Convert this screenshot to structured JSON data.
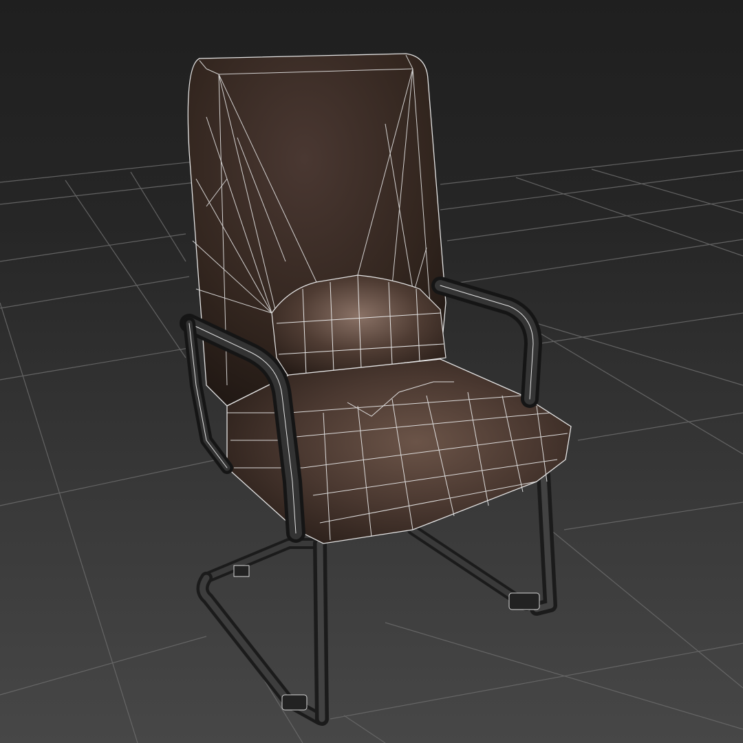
{
  "viewport": {
    "background_top": "#1f1f1f",
    "background_bottom": "#474747",
    "grid_color": "#6a6a6a",
    "wireframe_color": "#e8e8e8"
  },
  "model": {
    "object": "chair-model",
    "upholstery": "#3a2a24",
    "upholstery_highlight": "#7a6458",
    "frame": "#2b2b2b",
    "frame_highlight": "#5a5a5a"
  }
}
